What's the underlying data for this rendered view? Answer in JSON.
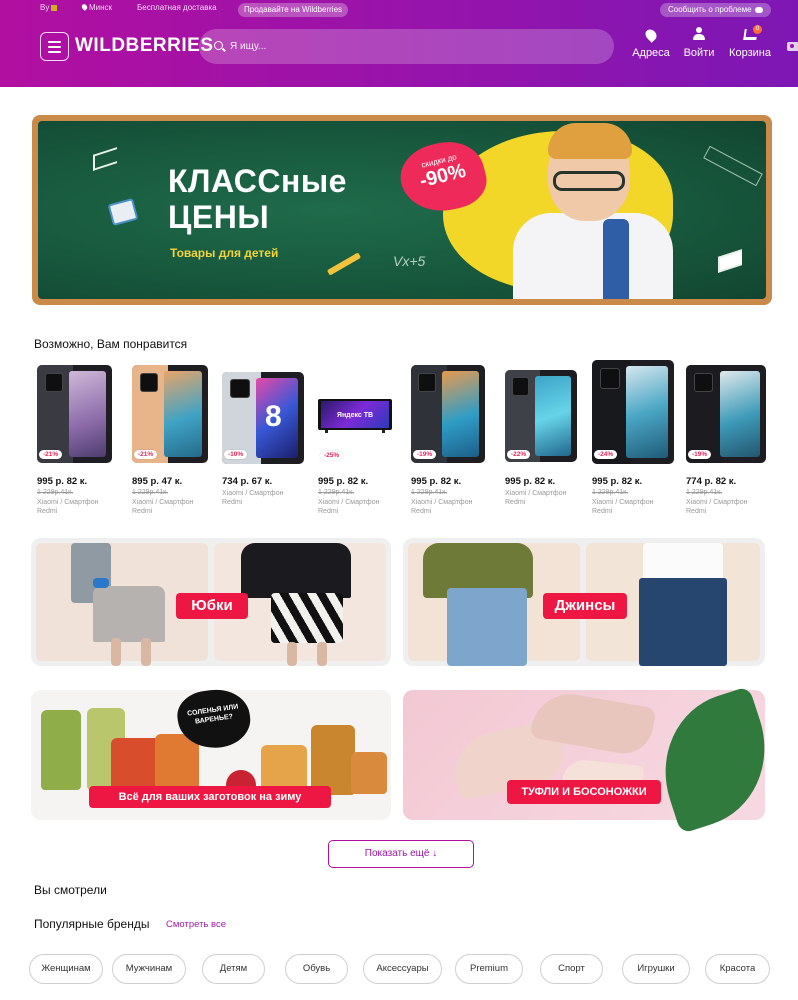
{
  "topbar": {
    "country": "By",
    "city": "Минск",
    "free_delivery": "Бесплатная доставка",
    "sell": "Продавайте на Wildberries",
    "report": "Сообщить о проблеме"
  },
  "header": {
    "logo": "WILDBERRIES",
    "search_placeholder": "Я ищу...",
    "nav": {
      "addresses": "Адреса",
      "login": "Войти",
      "cart": "Корзина"
    },
    "cart_count": "0",
    "brand_color": "#9b13a9"
  },
  "banner": {
    "title": "КЛАССные ЦЕНЫ",
    "subtitle": "Товары для детей",
    "badge_top": "скидки до",
    "badge_value": "-90%",
    "chalk_text": "Vx+5"
  },
  "recommendations": {
    "title": "Возможно, Вам понравится",
    "products": [
      {
        "discount": "-21%",
        "price": "995 р. 82 к.",
        "old_price": "1 229р.41к.",
        "name1": "Xiaomi / Смартфон",
        "name2": "Redmi"
      },
      {
        "discount": "-21%",
        "price": "895 р. 47 к.",
        "old_price": "1 229р.41к.",
        "name1": "Xiaomi / Смартфон",
        "name2": "Redmi"
      },
      {
        "discount": "-10%",
        "price": "734 р. 67 к.",
        "old_price": "",
        "name1": "Xiaomi / Смартфон",
        "name2": "Redmi",
        "screen_number": "8"
      },
      {
        "discount": "-25%",
        "price": "995 р. 82 к.",
        "old_price": "1 229р.41к.",
        "name1": "Xiaomi / Смартфон",
        "name2": "Redmi",
        "tv_brand": "Яндекс ТВ"
      },
      {
        "discount": "-19%",
        "price": "995 р. 82 к.",
        "old_price": "1 229р.41к.",
        "name1": "Xiaomi / Смартфон",
        "name2": "Redmi"
      },
      {
        "discount": "-22%",
        "price": "995 р. 82 к.",
        "old_price": "",
        "name1": "Xiaomi / Смартфон",
        "name2": "Redmi"
      },
      {
        "discount": "-24%",
        "price": "995 р. 82 к.",
        "old_price": "1 229р.41к.",
        "name1": "Xiaomi / Смартфон",
        "name2": "Redmi"
      },
      {
        "discount": "-19%",
        "price": "774 р. 82 к.",
        "old_price": "1 229р.41к.",
        "name1": "Xiaomi / Смартфон",
        "name2": "Redmi"
      }
    ]
  },
  "promos": {
    "skirts": "Юбки",
    "jeans": "Джинсы",
    "canning": "Всё для ваших заготовок на зиму",
    "canning_bubble": "СОЛЕНЬЯ ИЛИ ВАРЕНЬЕ?",
    "shoes": "ТУФЛИ И БОСОНОЖКИ"
  },
  "show_more": "Показать ещё ↓",
  "viewed_title": "Вы смотрели",
  "brands": {
    "title": "Популярные бренды",
    "see_all": "Смотреть все"
  },
  "categories": [
    "Женщинам",
    "Мужчинам",
    "Детям",
    "Обувь",
    "Аксессуары",
    "Premium",
    "Спорт",
    "Игрушки",
    "Красота"
  ]
}
